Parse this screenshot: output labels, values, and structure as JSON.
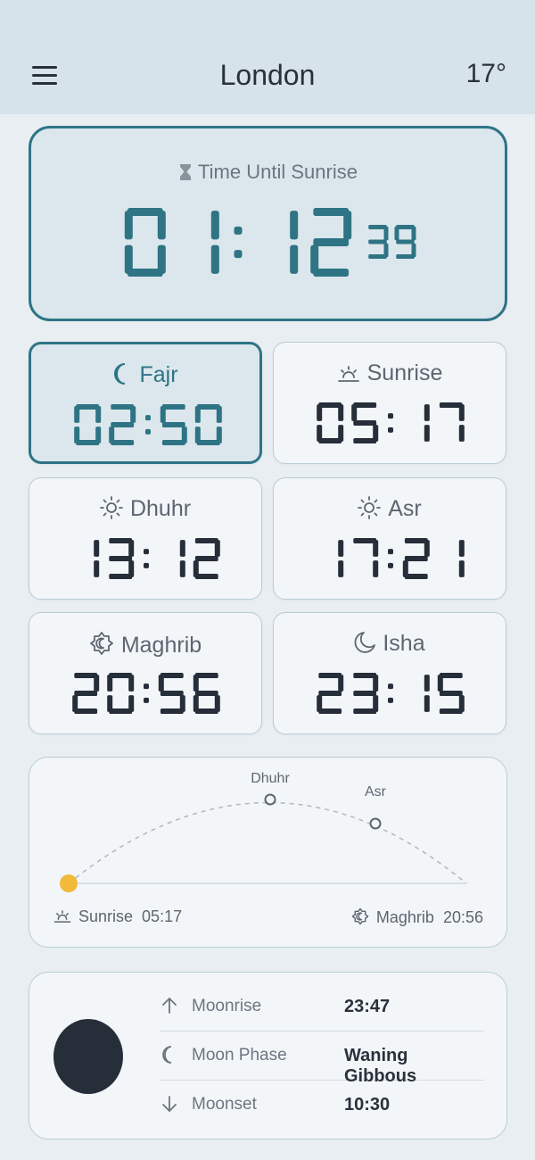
{
  "header": {
    "city": "London",
    "temperature": "17°"
  },
  "countdown": {
    "label": "Time Until Sunrise",
    "hours": "01",
    "minutes": "12",
    "seconds": "39"
  },
  "prayers": [
    {
      "name": "Fajr",
      "time": "02:50",
      "icon": "crescent-icon",
      "active": true
    },
    {
      "name": "Sunrise",
      "time": "05:17",
      "icon": "sunrise-icon",
      "active": false
    },
    {
      "name": "Dhuhr",
      "time": "13:12",
      "icon": "sun-icon",
      "active": false
    },
    {
      "name": "Asr",
      "time": "17:21",
      "icon": "sun-icon",
      "active": false
    },
    {
      "name": "Maghrib",
      "time": "20:56",
      "icon": "sunset-icon",
      "active": false
    },
    {
      "name": "Isha",
      "time": "23:15",
      "icon": "moon-icon",
      "active": false
    }
  ],
  "sun_arc": {
    "markers": [
      "Dhuhr",
      "Asr"
    ],
    "start_label": "Sunrise",
    "start_time": "05:17",
    "end_label": "Maghrib",
    "end_time": "20:56",
    "sun_color": "#f2b93b"
  },
  "moon": {
    "rows": [
      {
        "label": "Moonrise",
        "value": "23:47",
        "icon": "arrow-up-icon"
      },
      {
        "label": "Moon Phase",
        "value": "Waning Gibbous",
        "icon": "crescent-icon"
      },
      {
        "label": "Moonset",
        "value": "10:30",
        "icon": "arrow-down-icon"
      }
    ]
  },
  "colors": {
    "accent": "#2e7485",
    "digit": "#262e3a",
    "header_bg": "#d7e3ea"
  }
}
